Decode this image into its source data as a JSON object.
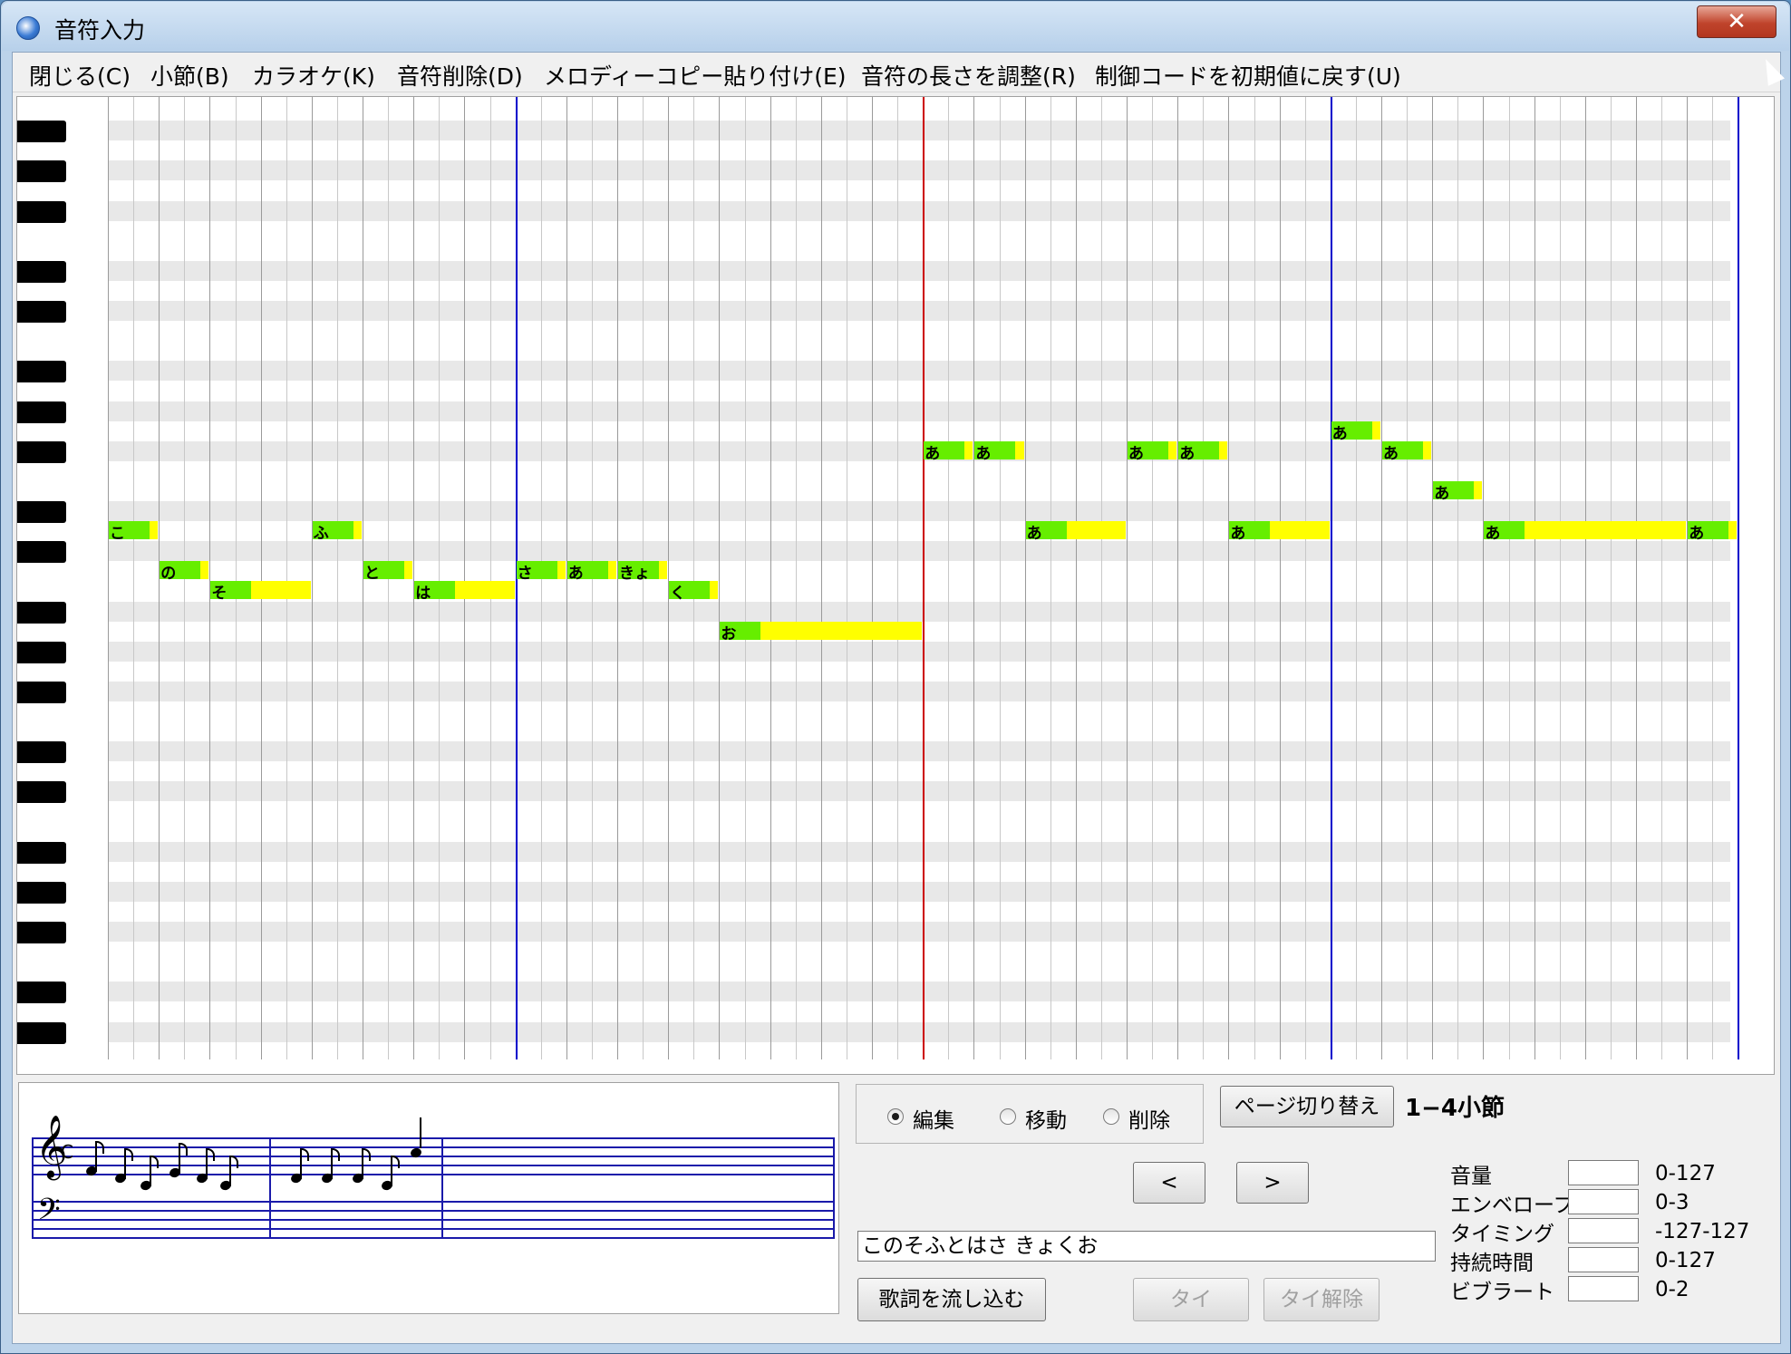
{
  "window": {
    "title": "音符入力",
    "close_glyph": "✕"
  },
  "menu": [
    {
      "label": "閉じる(C)"
    },
    {
      "label": "小節(B)"
    },
    {
      "label": "カラオケ(K)"
    },
    {
      "label": "音符削除(D)"
    },
    {
      "label": "メロディーコピー貼り付け(E)"
    },
    {
      "label": "音符の長さを調整(R)"
    },
    {
      "label": "制御コードを初期値に戻す(U)"
    }
  ],
  "notes": [
    {
      "lyric": "こ",
      "row": 21,
      "start": 0,
      "length": 2
    },
    {
      "lyric": "の",
      "row": 23,
      "start": 2,
      "length": 2
    },
    {
      "lyric": "そ",
      "row": 24,
      "start": 4,
      "length": 4
    },
    {
      "lyric": "ふ",
      "row": 21,
      "start": 8,
      "length": 2
    },
    {
      "lyric": "と",
      "row": 23,
      "start": 10,
      "length": 2
    },
    {
      "lyric": "は",
      "row": 24,
      "start": 12,
      "length": 4
    },
    {
      "lyric": "さ",
      "row": 23,
      "start": 16,
      "length": 2
    },
    {
      "lyric": "あ",
      "row": 23,
      "start": 18,
      "length": 2
    },
    {
      "lyric": "きょ",
      "row": 23,
      "start": 20,
      "length": 2
    },
    {
      "lyric": "く",
      "row": 24,
      "start": 22,
      "length": 2
    },
    {
      "lyric": "お",
      "row": 26,
      "start": 24,
      "length": 8
    },
    {
      "lyric": "あ",
      "row": 17,
      "start": 32,
      "length": 2
    },
    {
      "lyric": "あ",
      "row": 17,
      "start": 34,
      "length": 2
    },
    {
      "lyric": "あ",
      "row": 21,
      "start": 36,
      "length": 4
    },
    {
      "lyric": "あ",
      "row": 17,
      "start": 40,
      "length": 2
    },
    {
      "lyric": "あ",
      "row": 17,
      "start": 42,
      "length": 2
    },
    {
      "lyric": "あ",
      "row": 21,
      "start": 44,
      "length": 4
    },
    {
      "lyric": "あ",
      "row": 16,
      "start": 48,
      "length": 2
    },
    {
      "lyric": "あ",
      "row": 17,
      "start": 50,
      "length": 2
    },
    {
      "lyric": "あ",
      "row": 19,
      "start": 52,
      "length": 2
    },
    {
      "lyric": "あ",
      "row": 21,
      "start": 54,
      "length": 8
    },
    {
      "lyric": "あ",
      "row": 21,
      "start": 62,
      "length": 2
    }
  ],
  "mode": {
    "options": [
      {
        "label": "編集"
      },
      {
        "label": "移動"
      },
      {
        "label": "削除"
      }
    ],
    "selected": "編集"
  },
  "page_switch_label": "ページ切り替え",
  "page_range": "1−4小節",
  "prev_glyph": "<",
  "next_glyph": ">",
  "lyrics_value": "このそふとはさ きょくお",
  "flow_lyrics_label": "歌詞を流し込む",
  "tie_label": "タイ",
  "untie_label": "タイ解除",
  "params": [
    {
      "label": "音量",
      "range": "0-127",
      "value": ""
    },
    {
      "label": "エンベロープ",
      "range": "0-3",
      "value": ""
    },
    {
      "label": "タイミング",
      "range": "-127-127",
      "value": ""
    },
    {
      "label": "持続時間",
      "range": "0-127",
      "value": ""
    },
    {
      "label": "ビブラート",
      "range": "0-2",
      "value": ""
    }
  ],
  "colors": {
    "note_head": "#66ee00",
    "note_body": "#ffff00",
    "bar_line": "#0000cc",
    "page_line": "#cc0000",
    "scroll": "#0000ff"
  },
  "icons": {
    "app": "app-globe-icon",
    "close": "close-icon",
    "treble": "treble-clef-icon",
    "bass": "bass-clef-icon"
  }
}
